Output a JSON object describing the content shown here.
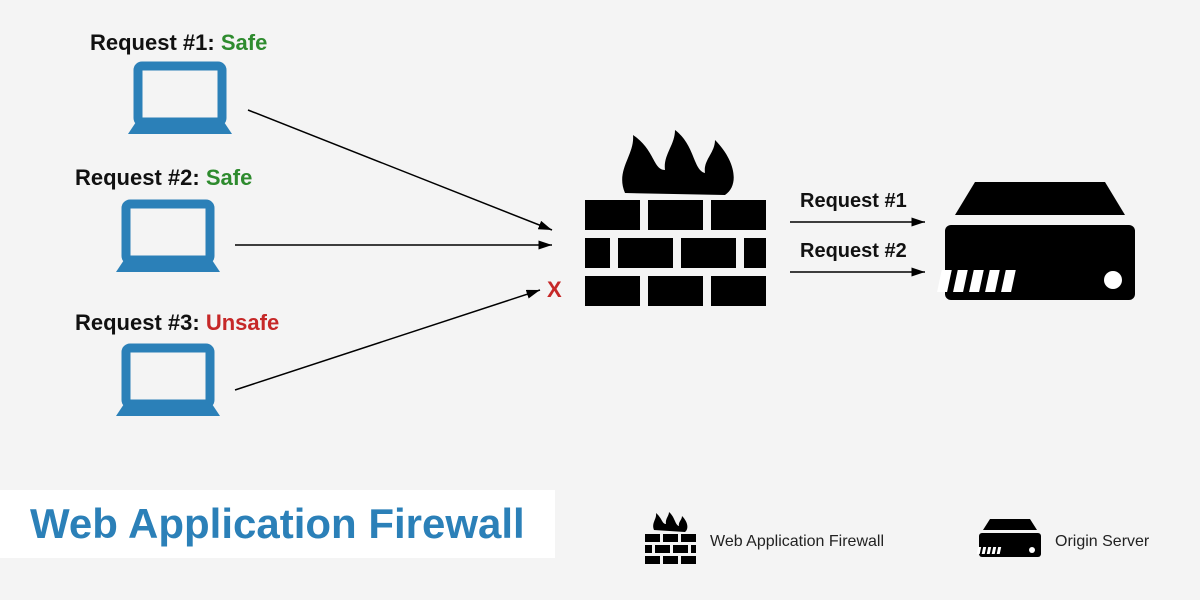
{
  "requests": [
    {
      "prefix": "Request #1: ",
      "status": "Safe",
      "safe": true
    },
    {
      "prefix": "Request #2: ",
      "status": "Safe",
      "safe": true
    },
    {
      "prefix": "Request #3: ",
      "status": "Unsafe",
      "safe": false
    }
  ],
  "blocked_marker": "X",
  "passed": [
    {
      "label": "Request #1"
    },
    {
      "label": "Request #2"
    }
  ],
  "title": "Web Application Firewall",
  "legend": {
    "waf": "Web Application Firewall",
    "origin": "Origin Server"
  },
  "colors": {
    "laptop": "#2b80b8",
    "black": "#000000",
    "safe": "#2e8b2e",
    "unsafe": "#c62828",
    "title": "#2b80b8"
  }
}
